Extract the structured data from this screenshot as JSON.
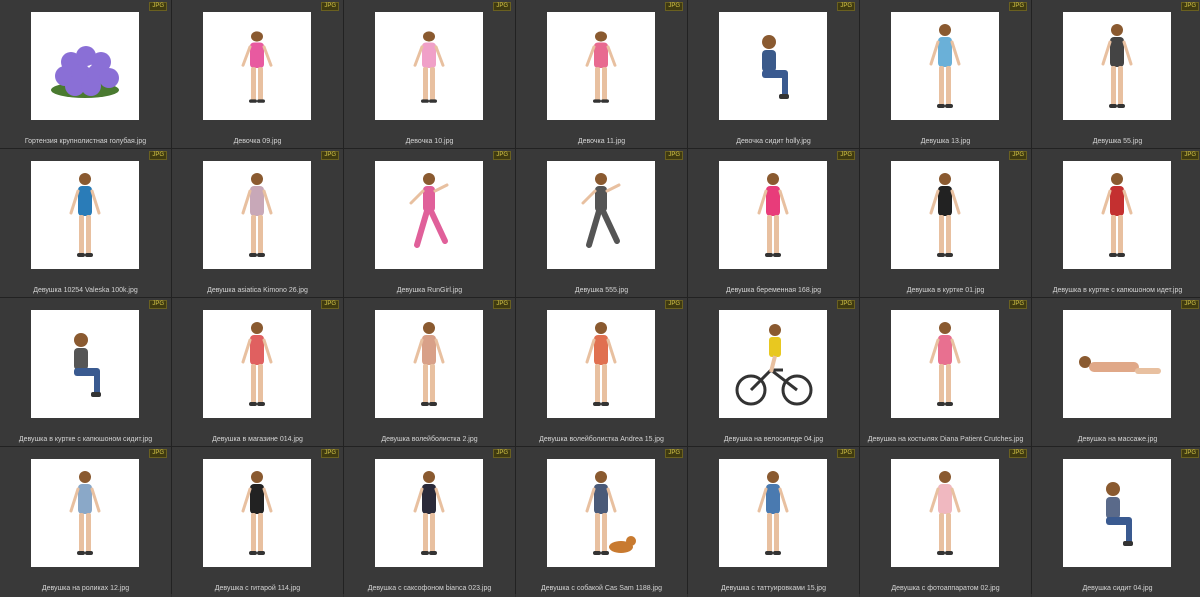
{
  "badge_label": "JPG",
  "files": [
    {
      "name": "Гортензия крупнолистная голубая.jpg",
      "icon": "flower-bush-icon",
      "color": "#8a6fd6"
    },
    {
      "name": "Девочка 09.jpg",
      "icon": "girl-figure-icon",
      "color": "#e85aa0"
    },
    {
      "name": "Девочка 10.jpg",
      "icon": "girl-figure-icon",
      "color": "#f0a0c8"
    },
    {
      "name": "Девочка 11.jpg",
      "icon": "girl-figure-icon",
      "color": "#e86a90"
    },
    {
      "name": "Девочка сидит holly.jpg",
      "icon": "sitting-figure-icon",
      "color": "#3b5a8a"
    },
    {
      "name": "Девушка 13.jpg",
      "icon": "woman-figure-icon",
      "color": "#6ab0d8"
    },
    {
      "name": "Девушка 55.jpg",
      "icon": "woman-figure-icon",
      "color": "#444444"
    },
    {
      "name": "Девушка 10254 Valeska 100k.jpg",
      "icon": "woman-figure-icon",
      "color": "#2a7cb8"
    },
    {
      "name": "Девушка asiatica Kimono 26.jpg",
      "icon": "woman-figure-icon",
      "color": "#c8a8b8"
    },
    {
      "name": "Девушка RunGirl.jpg",
      "icon": "running-figure-icon",
      "color": "#e0609a"
    },
    {
      "name": "Девушка 555.jpg",
      "icon": "stretching-figure-icon",
      "color": "#555555"
    },
    {
      "name": "Девушка беременная 168.jpg",
      "icon": "woman-figure-icon",
      "color": "#e83c7a"
    },
    {
      "name": "Девушка в куртке 01.jpg",
      "icon": "woman-figure-icon",
      "color": "#222222"
    },
    {
      "name": "Девушка в куртке с капюшоном идет.jpg",
      "icon": "woman-figure-icon",
      "color": "#c43030"
    },
    {
      "name": "Девушка в куртке с капюшоном сидит.jpg",
      "icon": "sitting-figure-icon",
      "color": "#555555"
    },
    {
      "name": "Девушка в магазине 014.jpg",
      "icon": "woman-figure-icon",
      "color": "#e06060"
    },
    {
      "name": "Девушка волейболистка 2.jpg",
      "icon": "woman-figure-icon",
      "color": "#d8a088"
    },
    {
      "name": "Девушка волейболистка Andrea 15.jpg",
      "icon": "woman-figure-icon",
      "color": "#e07050"
    },
    {
      "name": "Девушка на велосипеде 04.jpg",
      "icon": "bicycle-rider-icon",
      "color": "#e8c820"
    },
    {
      "name": "Девушка на костылях Diana Patient Crutches.jpg",
      "icon": "woman-figure-icon",
      "color": "#e87090"
    },
    {
      "name": "Девушка на массаже.jpg",
      "icon": "lying-figure-icon",
      "color": "#e0a888"
    },
    {
      "name": "Девушка на роликах 12.jpg",
      "icon": "woman-figure-icon",
      "color": "#8aa8c8"
    },
    {
      "name": "Девушка с гитарой 114.jpg",
      "icon": "woman-figure-icon",
      "color": "#222222"
    },
    {
      "name": "Девушка с саксофоном bianca 023.jpg",
      "icon": "woman-figure-icon",
      "color": "#2a2a3a"
    },
    {
      "name": "Девушка с собакой Cas Sam 1188.jpg",
      "icon": "woman-with-dog-icon",
      "color": "#4a5a78"
    },
    {
      "name": "Девушка с таттуировками 15.jpg",
      "icon": "woman-figure-icon",
      "color": "#4a7ab0"
    },
    {
      "name": "Девушка с фотоаппаратом 02.jpg",
      "icon": "woman-figure-icon",
      "color": "#f0b8c0"
    },
    {
      "name": "Девушка сидит 04.jpg",
      "icon": "sitting-figure-icon",
      "color": "#5a6a8a"
    }
  ]
}
